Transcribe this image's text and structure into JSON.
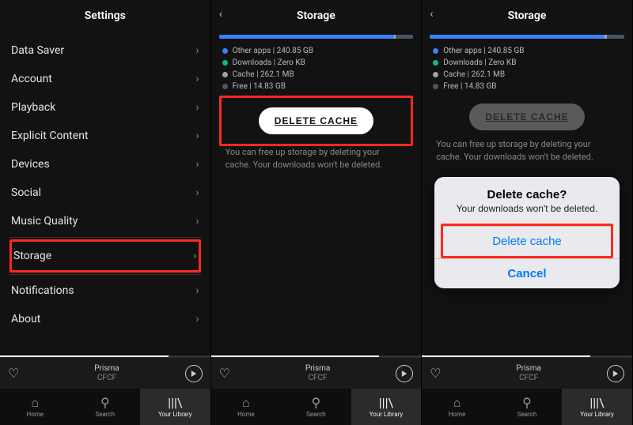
{
  "panel1": {
    "title": "Settings",
    "items": [
      {
        "label": "Data Saver"
      },
      {
        "label": "Account"
      },
      {
        "label": "Playback"
      },
      {
        "label": "Explicit Content"
      },
      {
        "label": "Devices"
      },
      {
        "label": "Social"
      },
      {
        "label": "Music Quality"
      },
      {
        "label": "Storage",
        "highlight": true
      },
      {
        "label": "Notifications"
      },
      {
        "label": "About"
      }
    ]
  },
  "storage": {
    "title": "Storage",
    "legend": [
      {
        "label": "Other apps | 240.85 GB",
        "color": "blue"
      },
      {
        "label": "Downloads | Zero KB",
        "color": "green"
      },
      {
        "label": "Cache | 262.1 MB",
        "color": "gray"
      },
      {
        "label": "Free | 14.83 GB",
        "color": "dark"
      }
    ],
    "delete_label": "DELETE CACHE",
    "desc": "You can free up storage by deleting your cache. Your downloads won't be deleted."
  },
  "dialog": {
    "title": "Delete cache?",
    "msg": "Your downloads won't be deleted.",
    "confirm": "Delete cache",
    "cancel": "Cancel"
  },
  "now_playing": {
    "track": "Prisma",
    "artist": "CFCF"
  },
  "tabs": {
    "home": "Home",
    "search": "Search",
    "library": "Your Library"
  }
}
